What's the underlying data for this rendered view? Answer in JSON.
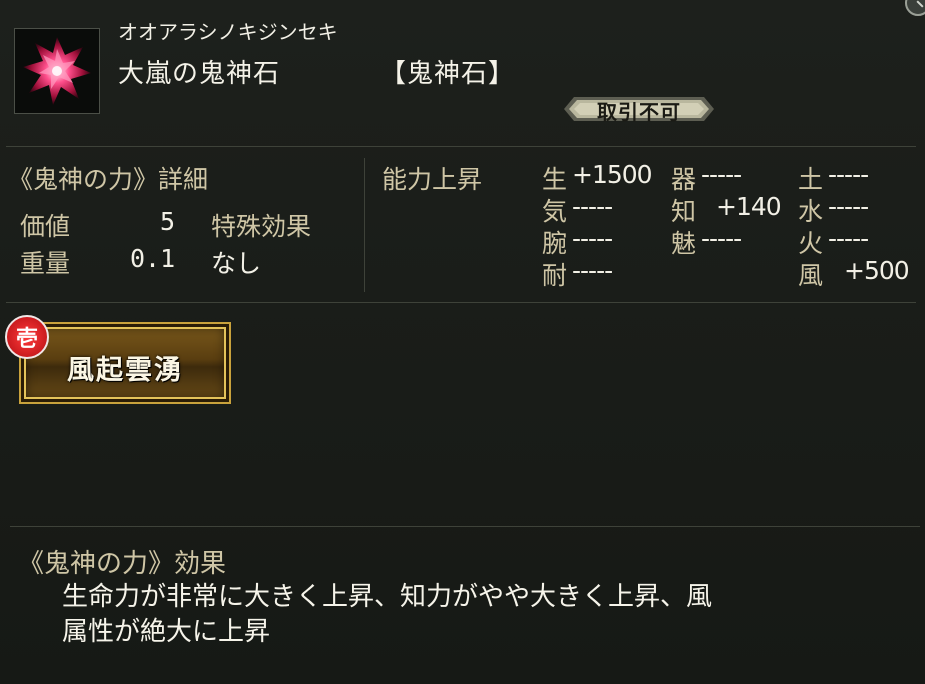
{
  "item": {
    "kana": "オオアラシノキジンセキ",
    "name": "大嵐の鬼神石",
    "type": "【鬼神石】",
    "trade_status": "取引不可",
    "icon": "crystal-gem-icon"
  },
  "details": {
    "section_title": "《鬼神の力》詳細",
    "value_label": "価値",
    "value": "5",
    "special_label": "特殊効果",
    "weight_label": "重量",
    "weight": "0.1",
    "special_value": "なし"
  },
  "ability": {
    "title": "能力上昇",
    "stats": [
      {
        "label": "生",
        "value": "+1500"
      },
      {
        "label": "器",
        "value": "-----"
      },
      {
        "label": "土",
        "value": "-----"
      },
      {
        "label": "気",
        "value": "-----"
      },
      {
        "label": "知",
        "value": "+140"
      },
      {
        "label": "水",
        "value": "-----"
      },
      {
        "label": "腕",
        "value": "-----"
      },
      {
        "label": "魅",
        "value": "-----"
      },
      {
        "label": "火",
        "value": "-----"
      },
      {
        "label": "耐",
        "value": "-----"
      },
      {
        "label": "風",
        "value": "+500"
      }
    ]
  },
  "skill": {
    "rank": "壱",
    "name": "風起雲湧"
  },
  "effect": {
    "title": "《鬼神の力》効果",
    "line1": "生命力が非常に大きく上昇、知力がやや大きく上昇、風",
    "line2": "属性が絶大に上昇"
  },
  "colors": {
    "background": "#181b17",
    "label_tan": "#cfc6a6",
    "gold": "#c9a23c",
    "badge_red": "#d0151b"
  }
}
